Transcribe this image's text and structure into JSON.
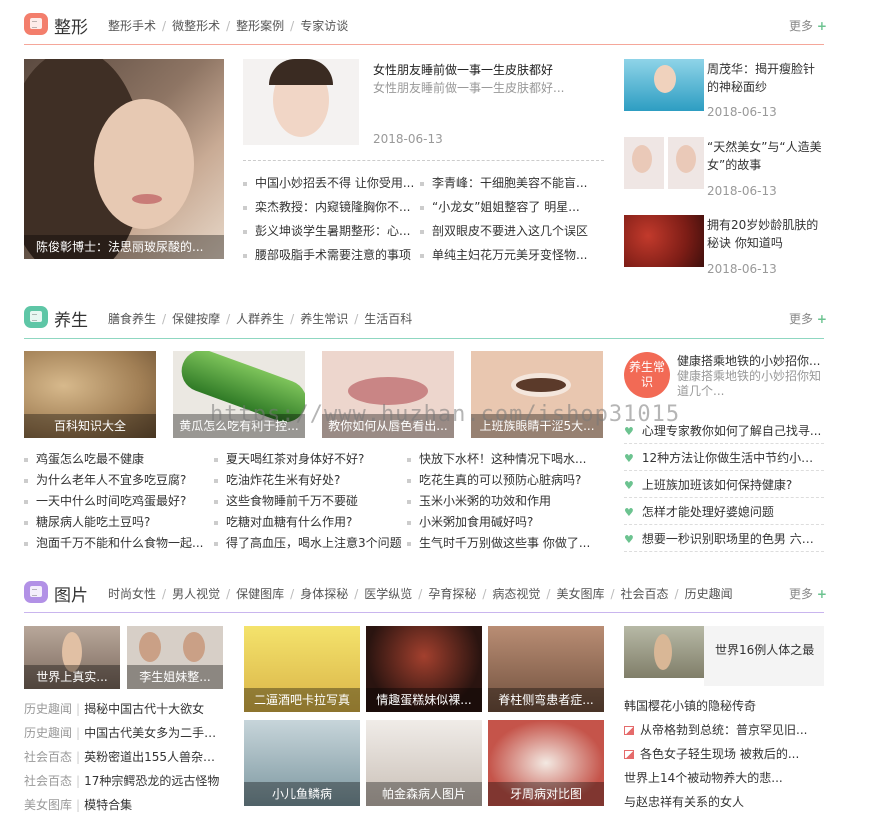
{
  "sections": {
    "zhengxing": {
      "title": "整形",
      "tabs": [
        "整形手术",
        "微整形术",
        "整形案例",
        "专家访谈"
      ],
      "more": "更多",
      "color": "#f37e6c"
    },
    "yangsheng": {
      "title": "养生",
      "tabs": [
        "膳食养生",
        "保健按摩",
        "人群养生",
        "养生常识",
        "生活百科"
      ],
      "more": "更多",
      "color": "#5ec6a6"
    },
    "tupian": {
      "title": "图片",
      "tabs": [
        "时尚女性",
        "男人视觉",
        "保健图库",
        "身体探秘",
        "医学纵览",
        "孕育探秘",
        "病态视觉",
        "美女图库",
        "社会百态",
        "历史趣闻"
      ],
      "more": "更多",
      "color": "#b291e6"
    }
  },
  "zx": {
    "big_caption": "陈俊彰博士：法思丽玻尿酸的...",
    "feature": {
      "title": "女性朋友睡前做一事一生皮肤都好",
      "desc": "女性朋友睡前做一事一生皮肤都好...",
      "date": "2018-06-13"
    },
    "list_left": [
      "中国小妙招丢不得 让你受用...",
      "栾杰教授：内窥镜隆胸你不...",
      "彭义坤谈学生暑期整形：心...",
      "腰部吸脂手术需要注意的事项"
    ],
    "list_right": [
      "李青峰：干细胞美容不能盲...",
      "“小龙女”姐姐整容了 明星...",
      "剖双眼皮不要进入这几个误区",
      "单纯主妇花万元美牙变怪物..."
    ],
    "side": [
      {
        "title": "周茂华：揭开瘦脸针的神秘面纱",
        "date": "2018-06-13"
      },
      {
        "title": "“天然美女”与“人造美女”的故事",
        "date": "2018-06-13"
      },
      {
        "title": "拥有20岁妙龄肌肤的秘诀 你知道吗",
        "date": "2018-06-13"
      }
    ]
  },
  "ys": {
    "thumbs": [
      "百科知识大全",
      "黄瓜怎么吃有利于控...",
      "教你如何从唇色看出...",
      "上班族眼睛干涩5大..."
    ],
    "col1": [
      "鸡蛋怎么吃最不健康",
      "为什么老年人不宜多吃豆腐?",
      "一天中什么时间吃鸡蛋最好?",
      "糖尿病人能吃土豆吗?",
      "泡面千万不能和什么食物一起..."
    ],
    "col2": [
      "夏天喝红茶对身体好不好?",
      "吃油炸花生米有好处?",
      "这些食物睡前千万不要碰",
      "吃糖对血糖有什么作用?",
      "得了高血压，喝水上注意3个问题"
    ],
    "col3": [
      "快放下水杯！这种情况下喝水...",
      "吃花生真的可以预防心脏病吗?",
      "玉米小米粥的功效和作用",
      "小米粥加食用碱好吗?",
      "生气时千万别做这些事 你做了..."
    ],
    "badge": "养生常识",
    "feature_title": "健康搭乘地铁的小妙招你...",
    "feature_desc": "健康搭乘地铁的小妙招你知道几个...",
    "side_list": [
      "心理专家教你如何了解自己找寻...",
      "12种方法让你做生活中节约小能手",
      "上班族加班该如何保持健康?",
      "怎样才能处理好婆媳问题",
      "想要一秒识别职场里的色男 六大..."
    ]
  },
  "tp": {
    "thumbs_left": [
      "世界上真实...",
      "李生姐妹整..."
    ],
    "left_list": [
      {
        "cat": "历史趣闻",
        "title": "揭秘中国古代十大欲女"
      },
      {
        "cat": "历史趣闻",
        "title": "中国古代美女多为二手货吗"
      },
      {
        "cat": "社会百态",
        "title": "英粉密道出155人兽杂交..."
      },
      {
        "cat": "社会百态",
        "title": "17种宗鳄恐龙的远古怪物"
      },
      {
        "cat": "美女图库",
        "title": "模特合集"
      }
    ],
    "grid": [
      "二逼酒吧卡拉写真",
      "情趣蛋糕妹似裸...",
      "脊柱侧弯患者症...",
      "小儿鱼鳞病",
      "帕金森病人图片",
      "牙周病对比图"
    ],
    "feature_title": "世界16例人体之最",
    "right_list": [
      {
        "title": "韩国樱花小镇的隐秘传奇",
        "icon": false
      },
      {
        "title": "从帝格勃到总统：普京罕见旧...",
        "icon": true
      },
      {
        "title": "各色女子轻生现场 被救后的...",
        "icon": true
      },
      {
        "title": "世界上14个被动物养大的悲...",
        "icon": false
      },
      {
        "title": "与赵忠祥有关系的女人",
        "icon": false
      }
    ]
  },
  "watermark": "https://www.huzhan.com/ishop31015"
}
